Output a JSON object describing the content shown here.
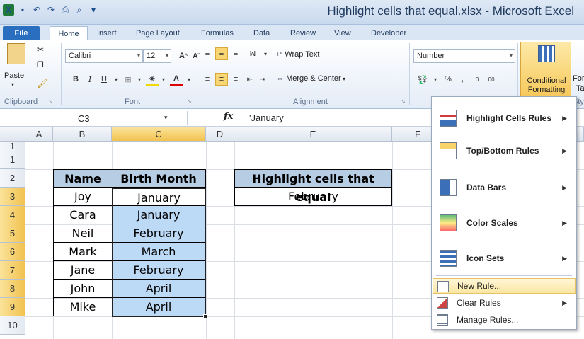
{
  "window": {
    "title": "Highlight cells that equal.xlsx  -  Microsoft Excel"
  },
  "tabs": [
    "File",
    "Home",
    "Insert",
    "Page Layout",
    "Formulas",
    "Data",
    "Review",
    "View",
    "Developer"
  ],
  "ribbon": {
    "paste_label": "Paste",
    "font_name": "Calibri",
    "font_size": "12",
    "wrap_text": "Wrap Text",
    "merge_center": "Merge & Center",
    "number_format": "Number",
    "conditional_formatting": "Conditional Formatting",
    "format_partial": "For",
    "format_partial2": "Ta",
    "styles_partial": "Styl",
    "groups": [
      "Clipboard",
      "Font",
      "Alignment"
    ]
  },
  "formula_bar": {
    "name_box": "C3",
    "fx": "fx",
    "value": "'January"
  },
  "columns": [
    "A",
    "B",
    "C",
    "D",
    "E",
    "F"
  ],
  "rows": [
    "1",
    "2",
    "3",
    "4",
    "5",
    "6",
    "7",
    "8",
    "9",
    "10"
  ],
  "table": {
    "headers": [
      "Name",
      "Birth Month"
    ],
    "rows": [
      [
        "Joy",
        "January"
      ],
      [
        "Cara",
        "January"
      ],
      [
        "Neil",
        "February"
      ],
      [
        "Mark",
        "March"
      ],
      [
        "Jane",
        "February"
      ],
      [
        "John",
        "April"
      ],
      [
        "Mike",
        "April"
      ]
    ]
  },
  "criteria": {
    "header": "Highlight cells that equal",
    "value": "February"
  },
  "menu": {
    "items": [
      {
        "label": "Highlight Cells Rules",
        "key": "H"
      },
      {
        "label": "Top/Bottom Rules",
        "key": "T"
      },
      {
        "label": "Data Bars",
        "key": "D"
      },
      {
        "label": "Color Scales",
        "key": "S"
      },
      {
        "label": "Icon Sets",
        "key": "I"
      }
    ],
    "small_items": [
      "New Rule...",
      "Clear Rules",
      "Manage Rules..."
    ]
  },
  "colors": {
    "header_fill": "#b7cde4",
    "highlight_fill": "#bcd9f6",
    "accent": "#2a6fbf"
  }
}
